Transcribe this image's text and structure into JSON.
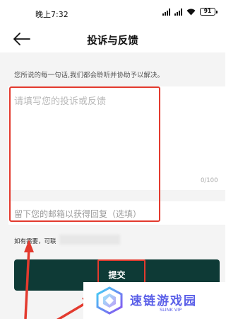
{
  "status_bar": {
    "time": "晚上7:32",
    "battery": "91"
  },
  "header": {
    "title": "投诉与反馈"
  },
  "intro": "您所说的每一句话,我们都会聆听并协助予以解决。",
  "form": {
    "feedback_placeholder": "请填写您的投诉或反馈",
    "char_count": "0/100",
    "email_placeholder": "留下您的邮箱以获得回复（选填）"
  },
  "contact_note": "如有需要，可联",
  "submit_label": "提交",
  "watermark": {
    "title": "速链游戏园",
    "subtitle": "SLINK VIP"
  },
  "colors": {
    "accent_dark": "#0e3a36",
    "annotation_red": "#e33a2e",
    "watermark_blue": "#5a5fe8"
  }
}
